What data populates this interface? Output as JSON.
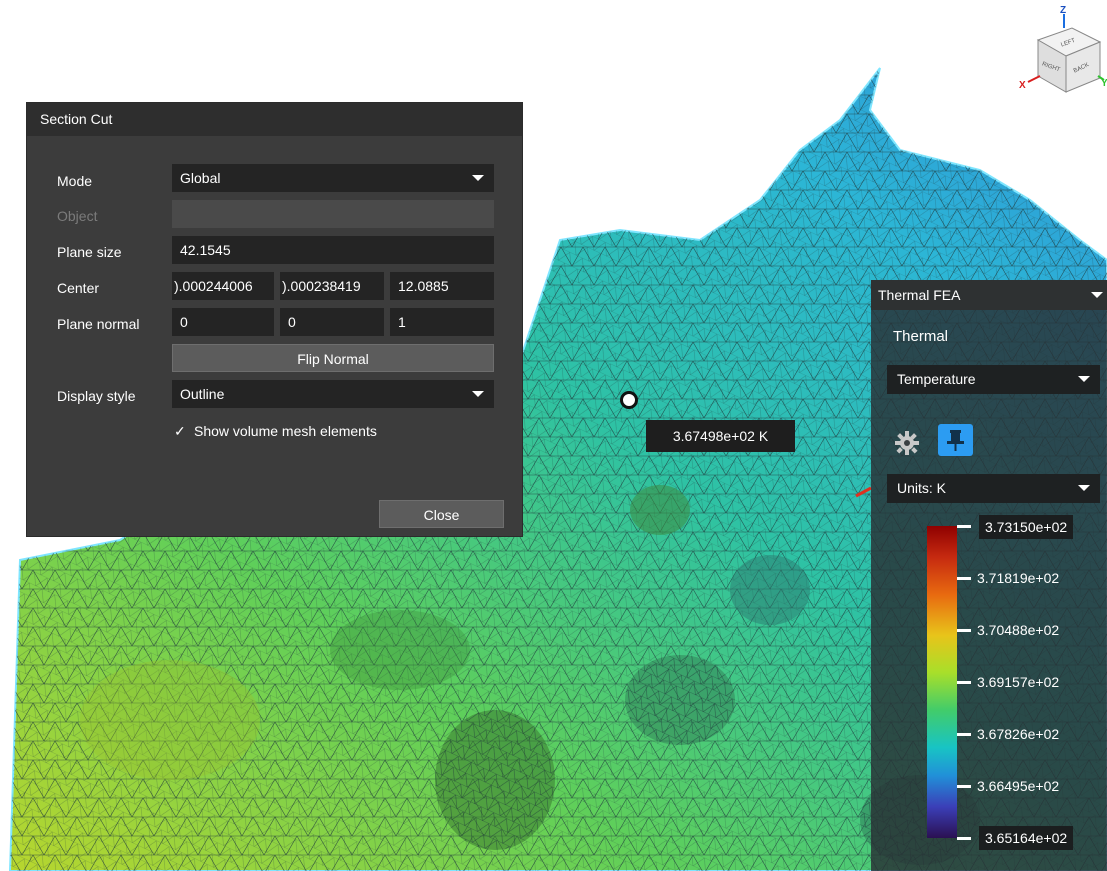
{
  "colors": {
    "mesh_edge": "#2a3a3f",
    "outline": "#7fe6ff",
    "dialog_bg": "#3c3c3c",
    "field_bg": "#242424",
    "accent_blue": "#2c9cf2"
  },
  "view_cube": {
    "axis_z": "Z",
    "axis_x": "X",
    "axis_y": "Y",
    "face_top": "LEFT",
    "face_front": "RIGHT",
    "face_side": "BACK"
  },
  "section_cut": {
    "title": "Section Cut",
    "mode_label": "Mode",
    "mode_value": "Global",
    "object_label": "Object",
    "object_value": "",
    "plane_size_label": "Plane size",
    "plane_size_value": "42.1545",
    "center_label": "Center",
    "center_x": ").000244006",
    "center_y": ").000238419",
    "center_z": "12.0885",
    "plane_normal_label": "Plane normal",
    "normal_x": "0",
    "normal_y": "0",
    "normal_z": "1",
    "flip_normal_label": "Flip Normal",
    "display_style_label": "Display style",
    "display_style_value": "Outline",
    "show_volume_mesh_label": "Show volume mesh elements",
    "show_volume_mesh_checked": "✓",
    "close_label": "Close"
  },
  "probe": {
    "value": "3.67498e+02 K"
  },
  "thermal_panel": {
    "title": "Thermal FEA",
    "section_label": "Thermal",
    "result_type": "Temperature",
    "units": "Units: K",
    "settings_icon": "gear-icon",
    "pin_icon": "pin-icon",
    "legend_ticks": [
      "3.73150e+02",
      "3.71819e+02",
      "3.70488e+02",
      "3.69157e+02",
      "3.67826e+02",
      "3.66495e+02",
      "3.65164e+02"
    ]
  }
}
